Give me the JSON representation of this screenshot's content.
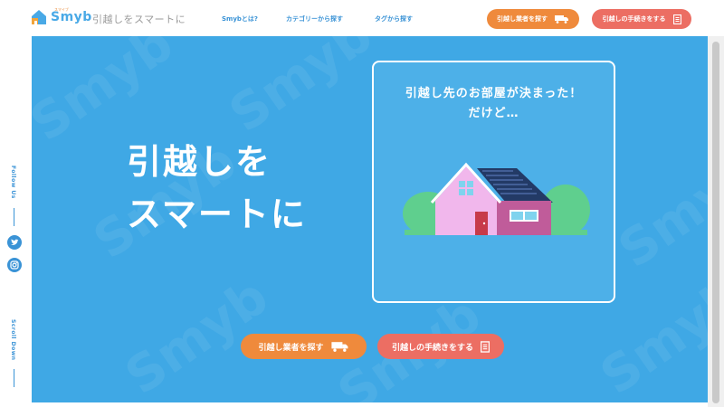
{
  "header": {
    "logo_text": "Smyb",
    "logo_sub": "スマイブ",
    "tagline": "引越しをスマートに",
    "nav": [
      {
        "label": "Smybとは?"
      },
      {
        "label": "カテゴリーから探す"
      },
      {
        "label": "タグから探す"
      }
    ],
    "cta_find": "引越し業者を探す",
    "cta_procedure": "引越しの手続きをする"
  },
  "sidebar": {
    "follow_label": "Follow Us",
    "scroll_label": "Scroll Down",
    "social": [
      {
        "icon": "twitter-icon"
      },
      {
        "icon": "instagram-icon"
      }
    ]
  },
  "hero": {
    "title_line1": "引越しを",
    "title_line2": "スマートに",
    "watermark": "Smyb",
    "card_line1": "引越し先のお部屋が決まった！",
    "card_line2": "だけど…",
    "cta_find": "引越し業者を探す",
    "cta_procedure": "引越しの手続きをする"
  },
  "colors": {
    "hero_bg": "#3fa8e5",
    "orange": "#ef8a3c",
    "red": "#ec6e63",
    "link": "#3a93d6"
  }
}
